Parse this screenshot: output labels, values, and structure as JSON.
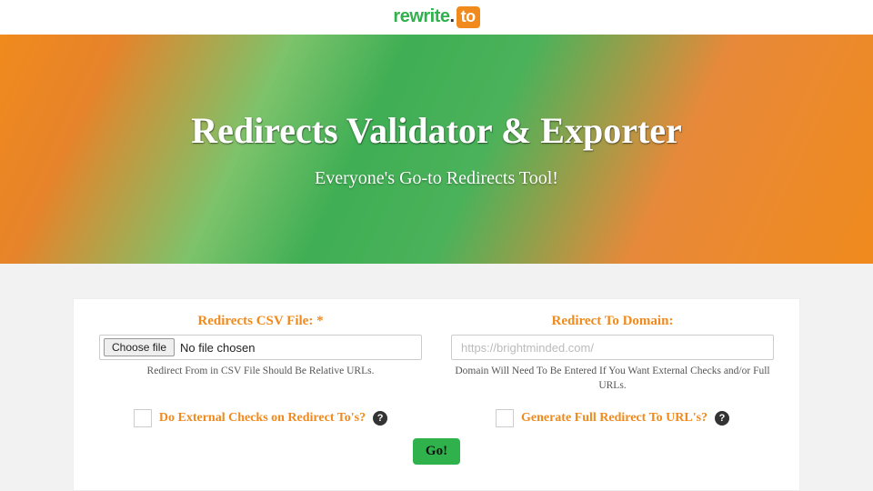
{
  "logo": {
    "part1": "rewrite",
    "dot": ".",
    "part2": "to"
  },
  "hero": {
    "title": "Redirects Validator & Exporter",
    "tagline": "Everyone's Go-to Redirects Tool!"
  },
  "form": {
    "csv": {
      "label": "Redirects CSV File: *",
      "choose_button": "Choose file",
      "file_state": "No file chosen",
      "sublabel": "Redirect From in CSV File Should Be Relative URLs."
    },
    "domain": {
      "label": "Redirect To Domain:",
      "placeholder": "https://brightminded.com/",
      "value": "",
      "sublabel": "Domain Will Need To Be Entered If You Want External Checks and/or Full URLs."
    },
    "checks": {
      "external_label": "Do External Checks on Redirect To's?",
      "fullurl_label": "Generate Full Redirect To URL's?",
      "help_glyph": "?"
    },
    "submit_label": "Go!"
  },
  "colors": {
    "accent_orange": "#f08a1d",
    "accent_green": "#2fb24c"
  }
}
